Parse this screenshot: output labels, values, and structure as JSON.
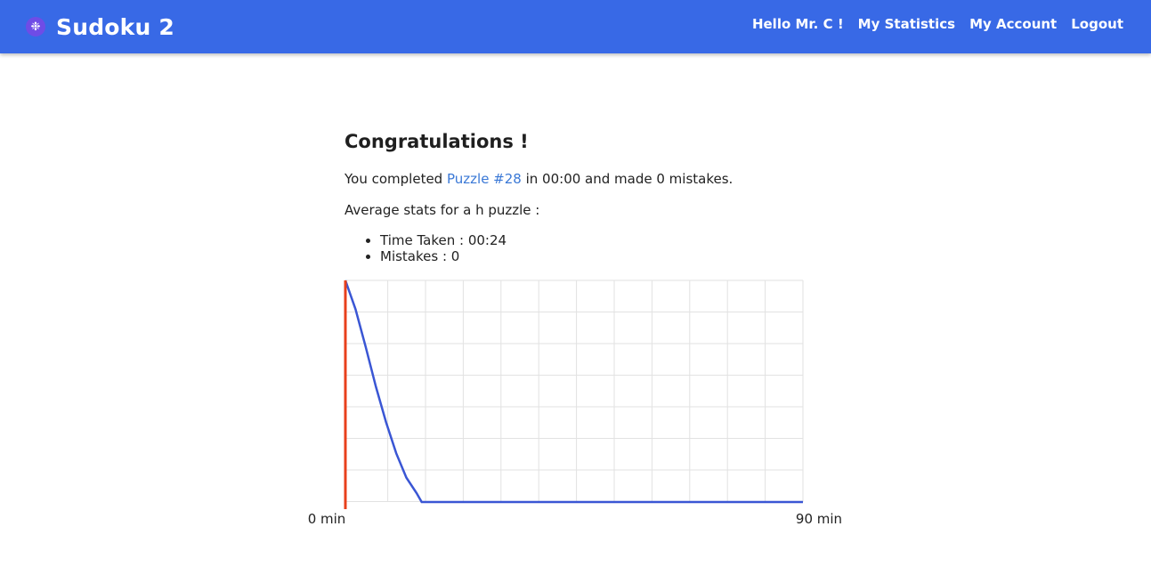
{
  "navbar": {
    "logo_icon": "sudoku-logo-icon",
    "brand": "Sudoku 2",
    "links": [
      {
        "label": "Hello Mr. C !"
      },
      {
        "label": "My Statistics"
      },
      {
        "label": "My Account"
      },
      {
        "label": "Logout"
      }
    ]
  },
  "main": {
    "heading": "Congratulations !",
    "completed_prefix": "You completed ",
    "puzzle_link": "Puzzle #28",
    "completed_suffix": " in 00:00 and made 0 mistakes.",
    "average_text": "Average stats for a h puzzle :",
    "stats": [
      {
        "label": "Time Taken : 00:24"
      },
      {
        "label": "Mistakes : 0"
      }
    ]
  },
  "colors": {
    "navbar": "#3869e6",
    "curve": "#3a56d4",
    "marker": "#e8401c",
    "link": "#3a78d6"
  },
  "chart_data": {
    "type": "line",
    "x_unit": "min",
    "xlim": [
      0,
      90
    ],
    "x_tick_labels": [
      "0 min",
      "90 min"
    ],
    "grid": true,
    "marker_x": 0,
    "series": [
      {
        "x": [
          0,
          2,
          4,
          6,
          8,
          10,
          12,
          14,
          15,
          20,
          30,
          45,
          60,
          75,
          90
        ],
        "y": [
          1.0,
          0.87,
          0.7,
          0.52,
          0.36,
          0.22,
          0.11,
          0.04,
          0.0,
          0.0,
          0.0,
          0.0,
          0.0,
          0.0,
          0.0
        ]
      }
    ]
  }
}
